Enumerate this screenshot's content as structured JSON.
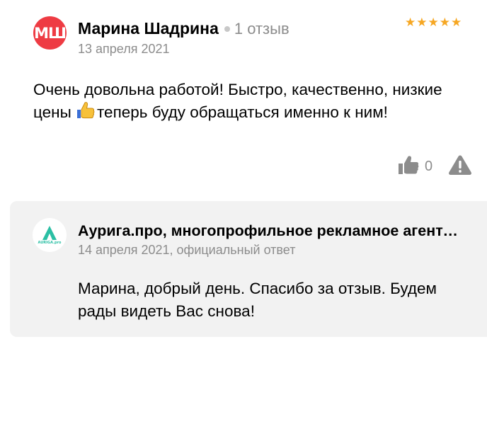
{
  "review": {
    "avatar_initials": "МШ",
    "author_name": "Марина Шадрина",
    "review_count": "1 отзыв",
    "date": "13 апреля 2021",
    "rating": 5,
    "stars": [
      "★",
      "★",
      "★",
      "★",
      "★"
    ],
    "text_before_emoji": "Очень довольна работой! Быстро, качественно, низкие цены ",
    "text_after_emoji": "теперь буду обращаться именно к ним!",
    "likes": "0"
  },
  "reply": {
    "logo_text": "AURIGA.pro",
    "author": "Аурига.про, многопрофильное рекламное агентство",
    "meta": "14 апреля 2021, официальный ответ",
    "text": "Марина, добрый день. Спасибо за отзыв. Будем рады видеть Вас снова!"
  },
  "colors": {
    "avatar_bg": "#ee3b43",
    "star": "#f6a723",
    "muted_text": "#8c8c8c",
    "reply_bg": "#f2f2f2",
    "logo_accent": "#2bbfa4"
  },
  "icons": {
    "like": "thumbs-up-icon",
    "report": "warning-triangle-icon",
    "emoji": "thumbs-up-emoji-icon"
  }
}
